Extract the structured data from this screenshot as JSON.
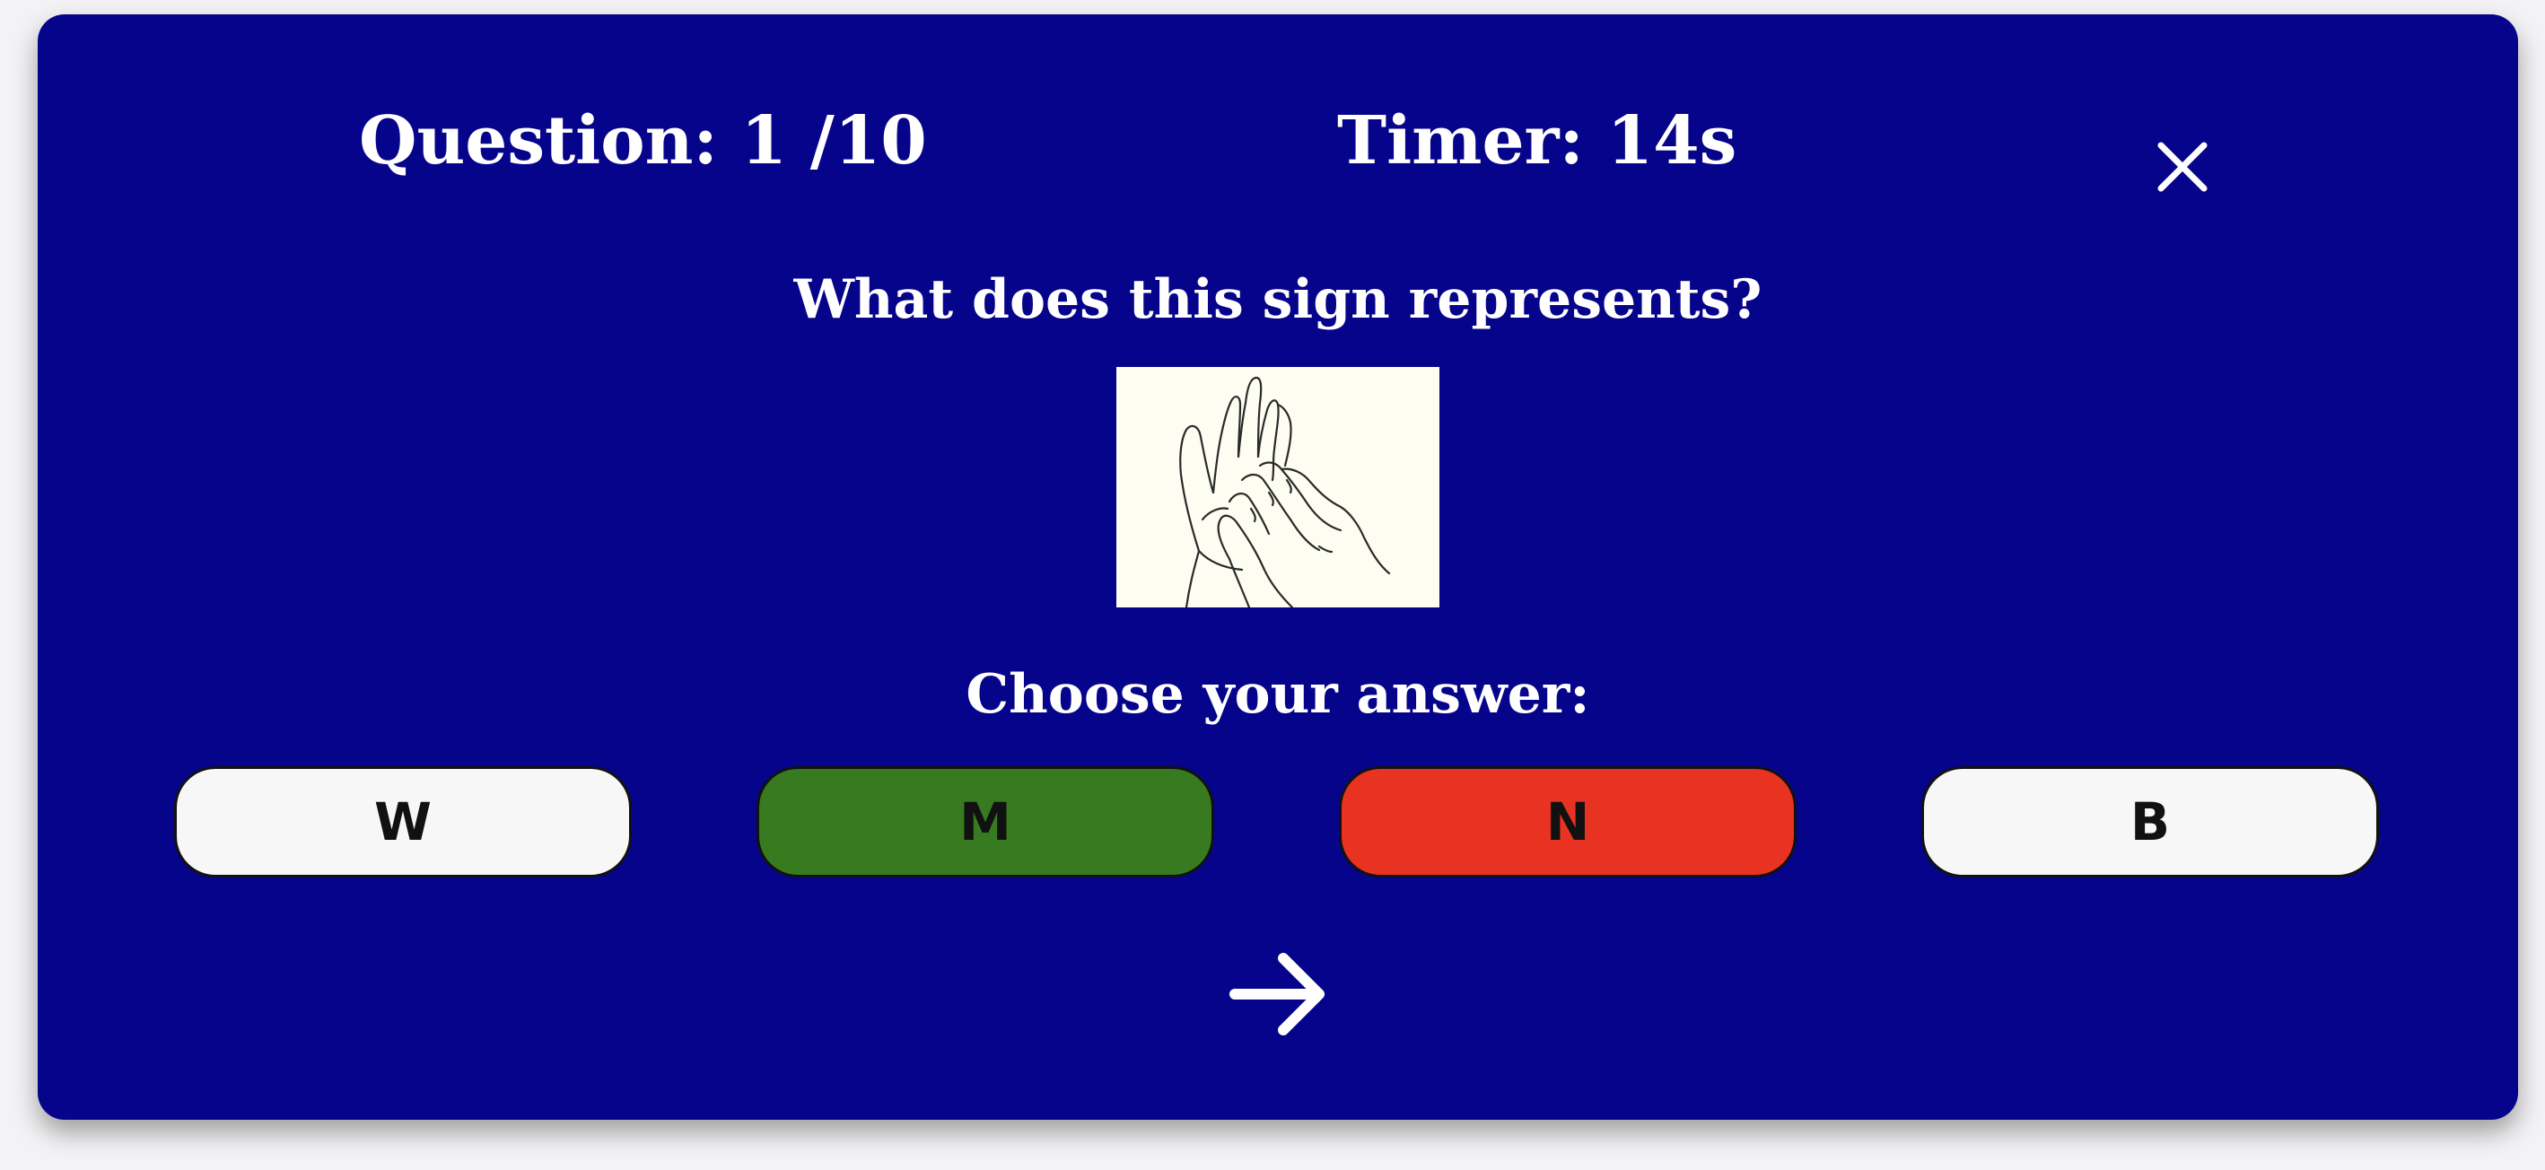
{
  "header": {
    "question_counter": "Question: 1 /10",
    "timer": "Timer: 14s"
  },
  "quiz": {
    "question": "What does this sign represents?",
    "choose_label": "Choose your answer:",
    "answers": [
      {
        "label": "W",
        "state": "neutral",
        "color": "#f7f7f7"
      },
      {
        "label": "M",
        "state": "correct",
        "color": "#377a1f"
      },
      {
        "label": "N",
        "state": "incorrect",
        "color": "#e83222"
      },
      {
        "label": "B",
        "state": "neutral",
        "color": "#f7f7f7"
      }
    ]
  },
  "icons": {
    "close": "close-icon",
    "next": "arrow-right-icon",
    "sign": "hand-sign-image"
  },
  "colors": {
    "panel": "#06048a",
    "text": "#ffffff",
    "correct": "#377a1f",
    "incorrect": "#e83222",
    "neutral": "#f7f7f7"
  }
}
